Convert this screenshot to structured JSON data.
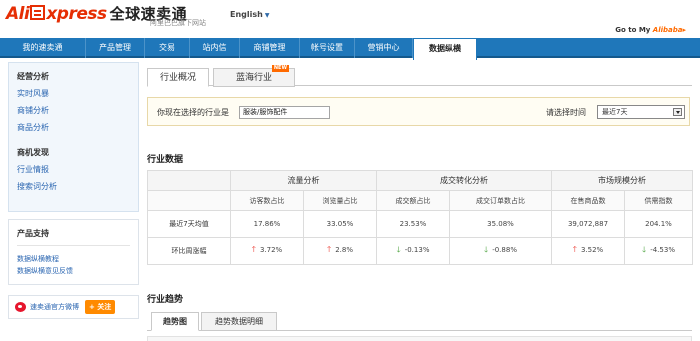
{
  "header": {
    "logo_ali": "Ali",
    "logo_xpress": "xpress",
    "logo_cn": "全球速卖通",
    "logo_sub": "阿里巴巴旗下网站",
    "lang_label": "English",
    "goto_prefix": "Go to My ",
    "goto_brand": "Alibaba",
    "goto_arrow": "▸"
  },
  "nav": {
    "items": [
      {
        "label": "我的速卖通"
      },
      {
        "label": "产品管理"
      },
      {
        "label": "交易"
      },
      {
        "label": "站内信"
      },
      {
        "label": "商铺管理"
      },
      {
        "label": "帐号设置"
      },
      {
        "label": "营销中心"
      },
      {
        "label": "数据纵横"
      }
    ]
  },
  "sidebar": {
    "section1_title": "经营分析",
    "section1_items": [
      "实时风暴",
      "商铺分析",
      "商品分析"
    ],
    "section2_title": "商机发现",
    "section2_items": [
      "行业情报",
      "搜索词分析"
    ],
    "support_title": "产品支持",
    "support_items": [
      "数据纵横教程",
      "数据纵横意见反馈"
    ],
    "weibo_label": "速卖通官方微博",
    "follow_label": "+ 关注"
  },
  "main": {
    "tabs": [
      {
        "label": "行业概况"
      },
      {
        "label": "蓝海行业"
      }
    ],
    "new_badge": "NEW",
    "selector": {
      "industry_label": "你现在选择的行业是",
      "industry_value": "服装/服饰配件",
      "time_label": "请选择时间",
      "time_value": "最近7天"
    },
    "industry_data_title": "行业数据",
    "table": {
      "groups": [
        "流量分析",
        "成交转化分析",
        "市场规模分析"
      ],
      "columns": [
        "访客数占比",
        "浏览量占比",
        "成交额占比",
        "成交订单数占比",
        "在售商品数",
        "供需指数"
      ],
      "rows": [
        {
          "label": "最近7天均值",
          "cells": [
            "17.86%",
            "33.05%",
            "23.53%",
            "35.08%",
            "39,072,887",
            "204.1%"
          ]
        },
        {
          "label": "环比周涨幅",
          "cells": [
            "3.72%",
            "2.8%",
            "-0.13%",
            "-0.88%",
            "3.52%",
            "-4.53%"
          ],
          "trends": [
            "up",
            "up",
            "down",
            "down",
            "up",
            "down"
          ]
        }
      ],
      "up_arrow": "🡑",
      "down_arrow": "🡓"
    },
    "trend_title": "行业趋势",
    "subtabs": [
      {
        "label": "趋势图"
      },
      {
        "label": "趋势数据明细"
      }
    ]
  },
  "colors": {
    "nav_bg": "#1f77ba",
    "brand": "#e62e04",
    "up": "#e8251b",
    "down": "#3c9a2c"
  }
}
